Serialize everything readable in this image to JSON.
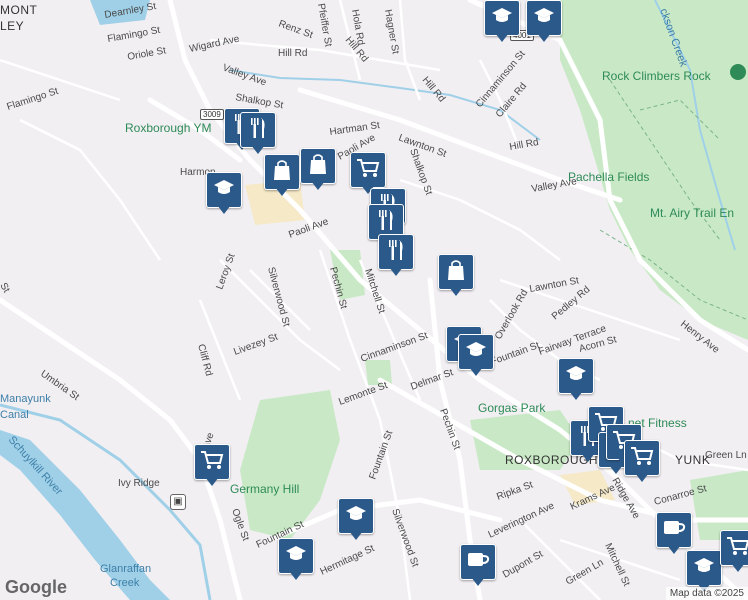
{
  "map": {
    "attribution": "Map data ©2025",
    "logo": "Google",
    "route_shields": [
      "3009",
      "4001"
    ],
    "areas": [
      "MONT",
      "LEY",
      "ROXBOROUGH",
      "YUNK"
    ],
    "parks": [
      "Roxborough YM",
      "Pachella Fields",
      "Mt. Airy Trail En",
      "Rock Climbers Rock",
      "Gorgas Park",
      "Germany Hill",
      "Planet Fitness"
    ],
    "water": [
      "Manayunk Canal",
      "Schuylkill River",
      "Glanraffan Creek",
      "Creek"
    ],
    "transit": "Ivy Ridge",
    "streets": [
      "Dearnley St",
      "Flamingo St",
      "Oriole St",
      "Wigard Ave",
      "Renz St",
      "Hill Rd",
      "Valley Ave",
      "Shalkop St",
      "Flamingo St",
      "Hartman St",
      "Lawnton St",
      "Paoli Ave",
      "Cinnaminson St",
      "Claire Rd",
      "Hill Rd",
      "Valley Ave",
      "Leroy St",
      "Silverwood St",
      "Pechin St",
      "Mitchell St",
      "Livezey St",
      "Cliff Rd",
      "Cinnaminson St",
      "Lemonte St",
      "Delmar St",
      "Fountain St",
      "Lawnton St",
      "Pedley Rd",
      "Fairway Terrace",
      "Overlook Rd",
      "Acorn St",
      "Henry Ave",
      "Umbria St",
      "Pechin St",
      "Ripka St",
      "Leverington Ave",
      "Ridge Ave",
      "Krams Ave",
      "Conarroe St",
      "Green Ln",
      "Ogle St",
      "Fountain St",
      "Hermitage St",
      "Silverwood St",
      "Dupont St",
      "Green Ln",
      "Mitchell St",
      "Harmon",
      "Hagner St",
      "Hola Rd",
      "Pfeiffer St",
      "Shalkop St"
    ]
  },
  "colors": {
    "pin": "#2b5a8a",
    "park": "#c9e9c6",
    "water": "#9fd0e8",
    "road": "#ffffff"
  },
  "pins": [
    {
      "icon": "school-icon"
    },
    {
      "icon": "school-icon"
    },
    {
      "icon": "restaurant-icon"
    },
    {
      "icon": "restaurant-icon"
    },
    {
      "icon": "shopping-bag-icon"
    },
    {
      "icon": "shopping-bag-icon"
    },
    {
      "icon": "school-icon"
    },
    {
      "icon": "shopping-cart-icon"
    },
    {
      "icon": "restaurant-icon"
    },
    {
      "icon": "restaurant-icon"
    },
    {
      "icon": "restaurant-icon"
    },
    {
      "icon": "shopping-bag-icon"
    },
    {
      "icon": "school-icon"
    },
    {
      "icon": "school-icon"
    },
    {
      "icon": "school-icon"
    },
    {
      "icon": "shopping-cart-icon"
    },
    {
      "icon": "restaurant-icon"
    },
    {
      "icon": "shopping-cart-icon"
    },
    {
      "icon": "coffee-icon"
    },
    {
      "icon": "shopping-cart-icon"
    },
    {
      "icon": "shopping-cart-icon"
    },
    {
      "icon": "school-icon"
    },
    {
      "icon": "school-icon"
    },
    {
      "icon": "coffee-icon"
    },
    {
      "icon": "coffee-icon"
    },
    {
      "icon": "school-icon"
    },
    {
      "icon": "shopping-cart-icon"
    }
  ]
}
